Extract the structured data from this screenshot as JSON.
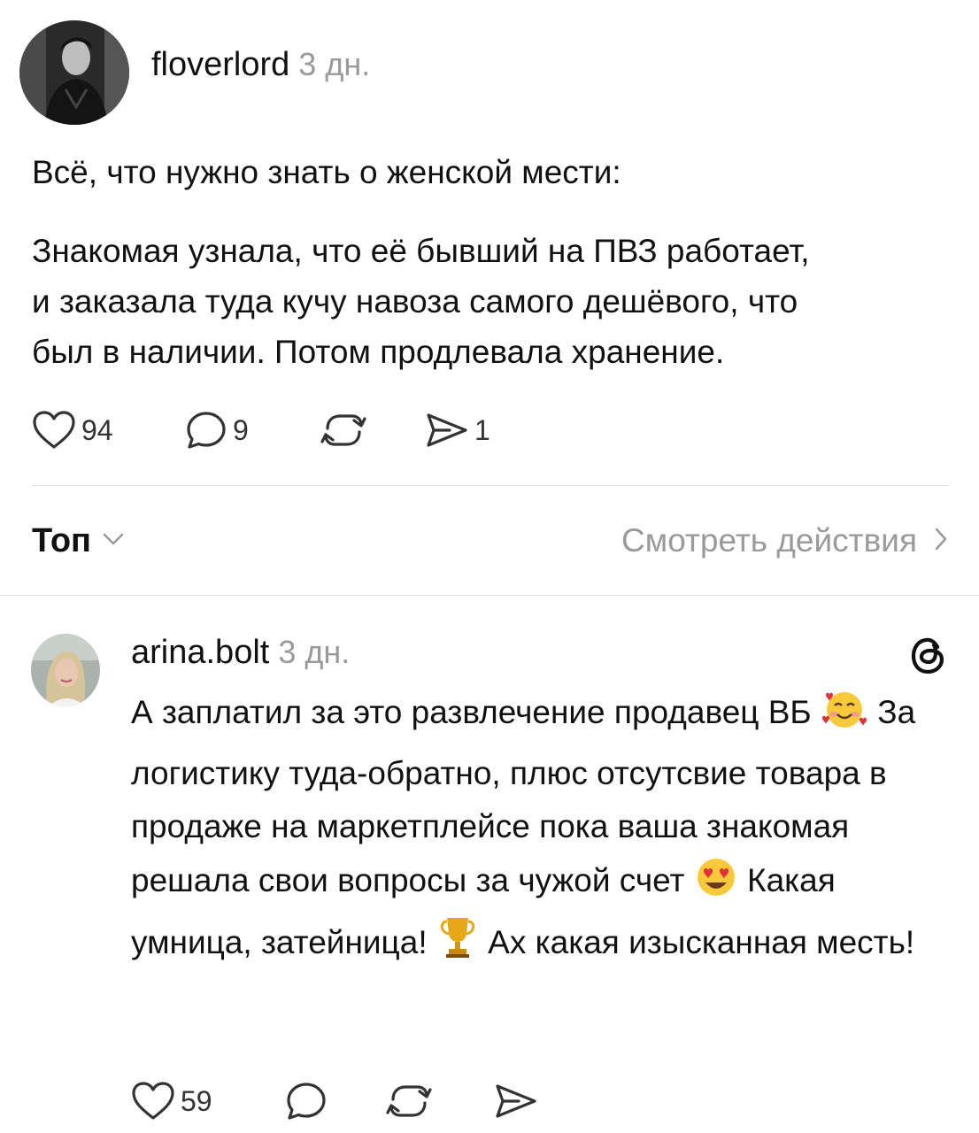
{
  "post": {
    "username": "floverlord",
    "time": "3 дн.",
    "paragraphs": [
      "Всё, что нужно знать о женской мести:",
      "Знакомая узнала, что её бывший на ПВЗ работает,\nи заказала туда кучу навоза самого дешёвого, что\nбыл в наличии. Потом продлевала хранение."
    ],
    "likes": "94",
    "comments": "9",
    "shares": "1"
  },
  "sort_bar": {
    "label": "Топ",
    "view_activity": "Смотреть действия"
  },
  "reply": {
    "username": "arina.bolt",
    "time": "3 дн.",
    "parts": [
      "А заплатил за это развлечение продавец ВБ",
      "За логистику туда-обратно, плюс отсутсвие товара в продаже на маркетплейсе пока ваша знакомая решала свои вопросы за чужой счет",
      "Какая умница, затейница!",
      "Ах какая изысканная месть!"
    ],
    "emojis": [
      "smiling-face-with-hearts",
      "heart-eyes",
      "trophy"
    ],
    "likes": "59"
  },
  "icons": [
    "heart-icon",
    "comment-icon",
    "repost-icon",
    "share-icon",
    "chevron-down-icon",
    "chevron-right-icon",
    "threads-logo-icon"
  ]
}
